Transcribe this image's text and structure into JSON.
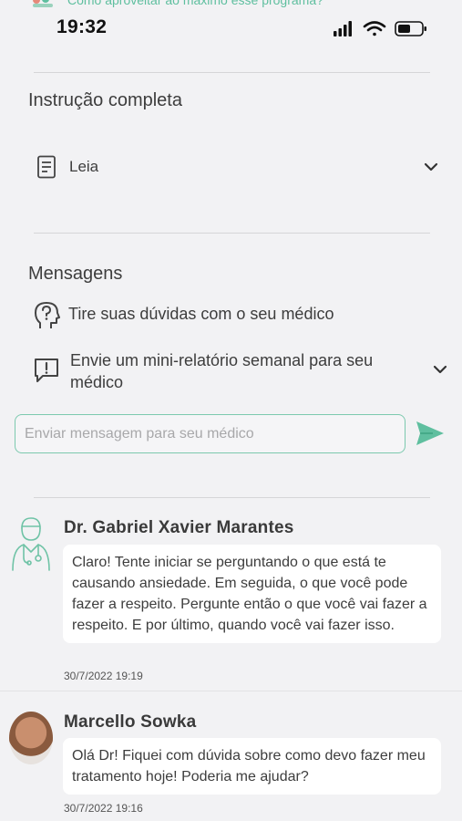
{
  "topbar": {
    "link_text": "Como aproveitar ao máximo esse programa?"
  },
  "status": {
    "time": "19:32"
  },
  "instructions": {
    "title": "Instrução completa",
    "item_label": "Leia"
  },
  "messages_section": {
    "title": "Mensagens",
    "ask_label": "Tire suas dúvidas com o seu médico",
    "report_label": "Envie um mini-relatório semanal para seu médico",
    "input_placeholder": "Enviar mensagem para seu médico"
  },
  "conversation": [
    {
      "sender": "Dr. Gabriel Xavier Marantes",
      "text": "Claro! Tente iniciar se perguntando o que está te causando ansiedade. Em seguida, o que você pode fazer a respeito. Pergunte então o que você vai fazer a respeito. E por último, quando você vai fazer isso.",
      "time": "30/7/2022 19:19"
    },
    {
      "sender": "Marcello Sowka",
      "text": "Olá Dr! Fiquei com dúvida sobre como devo fazer meu tratamento hoje! Poderia me ajudar?",
      "time": "30/7/2022 19:16"
    }
  ],
  "colors": {
    "accent": "#5fbf9f",
    "input_border": "#7cc9ae",
    "background": "#f2f2f4"
  },
  "icons": [
    "document-icon",
    "chevron-down-icon",
    "question-head-icon",
    "exclamation-chat-icon",
    "send-icon",
    "doctor-avatar-icon"
  ]
}
